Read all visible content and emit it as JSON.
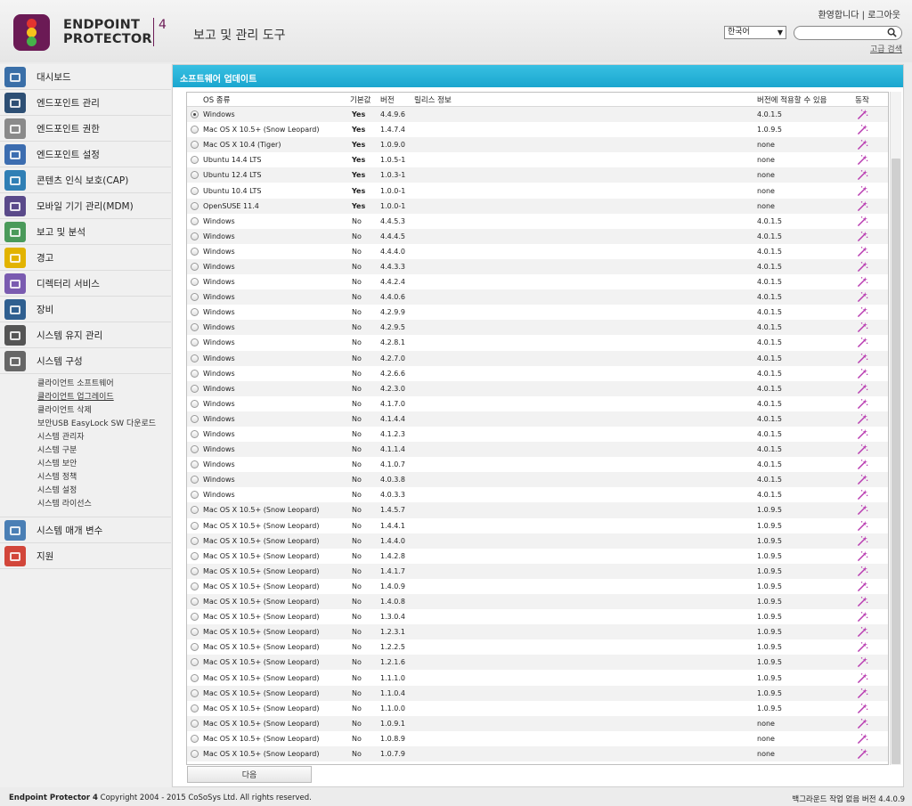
{
  "brand": {
    "line1": "ENDPOINT",
    "line2": "PROTECTOR",
    "version_num": "4"
  },
  "header": {
    "title": "보고 및 관리 도구",
    "welcome": "환영합니다",
    "separator": "|",
    "logout": "로그아웃",
    "language": "한국어",
    "search_placeholder": "",
    "advanced_search": "고급 검색"
  },
  "sidebar": {
    "items": [
      {
        "label": "대시보드",
        "icon": "dashboard-icon",
        "color": "#3a6fa8"
      },
      {
        "label": "엔드포인트 관리",
        "icon": "laptop-icon",
        "color": "#2d4f74"
      },
      {
        "label": "엔드포인트 권한",
        "icon": "keys-icon",
        "color": "#8a8a8a"
      },
      {
        "label": "엔드포인트 설정",
        "icon": "tools-icon",
        "color": "#3c6db0"
      },
      {
        "label": "콘텐츠 인식 보호(CAP)",
        "icon": "cap-icon",
        "color": "#2f7fb5"
      },
      {
        "label": "모바일 기기 관리(MDM)",
        "icon": "tablet-icon",
        "color": "#5a4a8a"
      },
      {
        "label": "보고 및 분석",
        "icon": "chart-icon",
        "color": "#4a9a5a"
      },
      {
        "label": "경고",
        "icon": "warning-icon",
        "color": "#e2b300"
      },
      {
        "label": "디렉터리 서비스",
        "icon": "sync-icon",
        "color": "#7a5bb0"
      },
      {
        "label": "장비",
        "icon": "device-icon",
        "color": "#2f5f90"
      },
      {
        "label": "시스템 유지 관리",
        "icon": "wrench-icon",
        "color": "#555555"
      },
      {
        "label": "시스템 구성",
        "icon": "gear-icon",
        "color": "#666666"
      }
    ],
    "sub_items": [
      {
        "label": "클라이언트 소프트웨어",
        "active": false
      },
      {
        "label": "클라이언트 업그레이드",
        "active": true
      },
      {
        "label": "클라이언트 삭제",
        "active": false
      },
      {
        "label": "보안USB EasyLock SW 다운로드",
        "active": false
      },
      {
        "label": "시스템 관리자",
        "active": false
      },
      {
        "label": "시스템 구분",
        "active": false
      },
      {
        "label": "시스템 보안",
        "active": false
      },
      {
        "label": "시스템 정책",
        "active": false
      },
      {
        "label": "시스템 설정",
        "active": false
      },
      {
        "label": "시스템 라이선스",
        "active": false
      }
    ],
    "bottom_items": [
      {
        "label": "시스템 매개 변수",
        "icon": "parameters-icon",
        "color": "#4a7fb5"
      },
      {
        "label": "지원",
        "icon": "lifebuoy-icon",
        "color": "#d2463a"
      }
    ]
  },
  "panel": {
    "title": "소프트웨어 업데이트",
    "columns": {
      "os": "OS 종류",
      "default": "기본값",
      "version": "버전",
      "release": "릴리스 정보",
      "applicable": "버전에 적용할 수 있음",
      "action": "동작"
    },
    "rows": [
      {
        "os": "Windows",
        "default": "Yes",
        "version": "4.4.9.6",
        "applicable": "4.0.1.5",
        "selected": true
      },
      {
        "os": "Mac OS X 10.5+ (Snow Leopard)",
        "default": "Yes",
        "version": "1.4.7.4",
        "applicable": "1.0.9.5"
      },
      {
        "os": "Mac OS X 10.4 (Tiger)",
        "default": "Yes",
        "version": "1.0.9.0",
        "applicable": "none"
      },
      {
        "os": "Ubuntu 14.4 LTS",
        "default": "Yes",
        "version": "1.0.5-1",
        "applicable": "none"
      },
      {
        "os": "Ubuntu 12.4 LTS",
        "default": "Yes",
        "version": "1.0.3-1",
        "applicable": "none"
      },
      {
        "os": "Ubuntu 10.4 LTS",
        "default": "Yes",
        "version": "1.0.0-1",
        "applicable": "none"
      },
      {
        "os": "OpenSUSE 11.4",
        "default": "Yes",
        "version": "1.0.0-1",
        "applicable": "none"
      },
      {
        "os": "Windows",
        "default": "No",
        "version": "4.4.5.3",
        "applicable": "4.0.1.5"
      },
      {
        "os": "Windows",
        "default": "No",
        "version": "4.4.4.5",
        "applicable": "4.0.1.5"
      },
      {
        "os": "Windows",
        "default": "No",
        "version": "4.4.4.0",
        "applicable": "4.0.1.5"
      },
      {
        "os": "Windows",
        "default": "No",
        "version": "4.4.3.3",
        "applicable": "4.0.1.5"
      },
      {
        "os": "Windows",
        "default": "No",
        "version": "4.4.2.4",
        "applicable": "4.0.1.5"
      },
      {
        "os": "Windows",
        "default": "No",
        "version": "4.4.0.6",
        "applicable": "4.0.1.5"
      },
      {
        "os": "Windows",
        "default": "No",
        "version": "4.2.9.9",
        "applicable": "4.0.1.5"
      },
      {
        "os": "Windows",
        "default": "No",
        "version": "4.2.9.5",
        "applicable": "4.0.1.5"
      },
      {
        "os": "Windows",
        "default": "No",
        "version": "4.2.8.1",
        "applicable": "4.0.1.5"
      },
      {
        "os": "Windows",
        "default": "No",
        "version": "4.2.7.0",
        "applicable": "4.0.1.5"
      },
      {
        "os": "Windows",
        "default": "No",
        "version": "4.2.6.6",
        "applicable": "4.0.1.5"
      },
      {
        "os": "Windows",
        "default": "No",
        "version": "4.2.3.0",
        "applicable": "4.0.1.5"
      },
      {
        "os": "Windows",
        "default": "No",
        "version": "4.1.7.0",
        "applicable": "4.0.1.5"
      },
      {
        "os": "Windows",
        "default": "No",
        "version": "4.1.4.4",
        "applicable": "4.0.1.5"
      },
      {
        "os": "Windows",
        "default": "No",
        "version": "4.1.2.3",
        "applicable": "4.0.1.5"
      },
      {
        "os": "Windows",
        "default": "No",
        "version": "4.1.1.4",
        "applicable": "4.0.1.5"
      },
      {
        "os": "Windows",
        "default": "No",
        "version": "4.1.0.7",
        "applicable": "4.0.1.5"
      },
      {
        "os": "Windows",
        "default": "No",
        "version": "4.0.3.8",
        "applicable": "4.0.1.5"
      },
      {
        "os": "Windows",
        "default": "No",
        "version": "4.0.3.3",
        "applicable": "4.0.1.5"
      },
      {
        "os": "Mac OS X 10.5+ (Snow Leopard)",
        "default": "No",
        "version": "1.4.5.7",
        "applicable": "1.0.9.5"
      },
      {
        "os": "Mac OS X 10.5+ (Snow Leopard)",
        "default": "No",
        "version": "1.4.4.1",
        "applicable": "1.0.9.5"
      },
      {
        "os": "Mac OS X 10.5+ (Snow Leopard)",
        "default": "No",
        "version": "1.4.4.0",
        "applicable": "1.0.9.5"
      },
      {
        "os": "Mac OS X 10.5+ (Snow Leopard)",
        "default": "No",
        "version": "1.4.2.8",
        "applicable": "1.0.9.5"
      },
      {
        "os": "Mac OS X 10.5+ (Snow Leopard)",
        "default": "No",
        "version": "1.4.1.7",
        "applicable": "1.0.9.5"
      },
      {
        "os": "Mac OS X 10.5+ (Snow Leopard)",
        "default": "No",
        "version": "1.4.0.9",
        "applicable": "1.0.9.5"
      },
      {
        "os": "Mac OS X 10.5+ (Snow Leopard)",
        "default": "No",
        "version": "1.4.0.8",
        "applicable": "1.0.9.5"
      },
      {
        "os": "Mac OS X 10.5+ (Snow Leopard)",
        "default": "No",
        "version": "1.3.0.4",
        "applicable": "1.0.9.5"
      },
      {
        "os": "Mac OS X 10.5+ (Snow Leopard)",
        "default": "No",
        "version": "1.2.3.1",
        "applicable": "1.0.9.5"
      },
      {
        "os": "Mac OS X 10.5+ (Snow Leopard)",
        "default": "No",
        "version": "1.2.2.5",
        "applicable": "1.0.9.5"
      },
      {
        "os": "Mac OS X 10.5+ (Snow Leopard)",
        "default": "No",
        "version": "1.2.1.6",
        "applicable": "1.0.9.5"
      },
      {
        "os": "Mac OS X 10.5+ (Snow Leopard)",
        "default": "No",
        "version": "1.1.1.0",
        "applicable": "1.0.9.5"
      },
      {
        "os": "Mac OS X 10.5+ (Snow Leopard)",
        "default": "No",
        "version": "1.1.0.4",
        "applicable": "1.0.9.5"
      },
      {
        "os": "Mac OS X 10.5+ (Snow Leopard)",
        "default": "No",
        "version": "1.1.0.0",
        "applicable": "1.0.9.5"
      },
      {
        "os": "Mac OS X 10.5+ (Snow Leopard)",
        "default": "No",
        "version": "1.0.9.1",
        "applicable": "none"
      },
      {
        "os": "Mac OS X 10.5+ (Snow Leopard)",
        "default": "No",
        "version": "1.0.8.9",
        "applicable": "none"
      },
      {
        "os": "Mac OS X 10.5+ (Snow Leopard)",
        "default": "No",
        "version": "1.0.7.9",
        "applicable": "none"
      }
    ],
    "next_button": "다음"
  },
  "footer": {
    "product": "Endpoint Protector 4",
    "copyright": "Copyright 2004 - 2015 CoSoSys Ltd. All rights reserved.",
    "background_tasks": "백그라운드 작업 없음",
    "version": "버전 4.4.0.9"
  },
  "colors": {
    "accent": "#1aa6cf",
    "brand": "#6b1a55",
    "wand": "#b83ab0"
  }
}
